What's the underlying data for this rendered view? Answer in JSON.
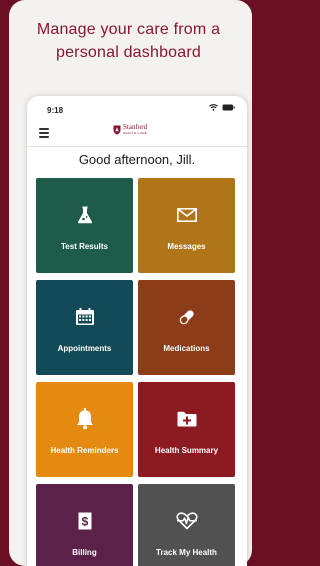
{
  "headline": {
    "line1": "Manage your care from a",
    "line2": "personal dashboard"
  },
  "status_bar": {
    "time": "9:18"
  },
  "app": {
    "logo_brand": "Stanford",
    "logo_sub": "HEALTH CARE",
    "greeting": "Good afternoon, Jill."
  },
  "tiles": [
    {
      "label": "Test Results",
      "icon": "flask-icon",
      "color": "#1e5b4b"
    },
    {
      "label": "Messages",
      "icon": "envelope-icon",
      "color": "#b07518"
    },
    {
      "label": "Appointments",
      "icon": "calendar-icon",
      "color": "#124a57"
    },
    {
      "label": "Medications",
      "icon": "pill-icon",
      "color": "#8c3c18"
    },
    {
      "label": "Health Reminders",
      "icon": "bell-icon",
      "color": "#e58a11"
    },
    {
      "label": "Health Summary",
      "icon": "medical-folder-icon",
      "color": "#8e1a21"
    },
    {
      "label": "Billing",
      "icon": "dollar-doc-icon",
      "color": "#5b2149"
    },
    {
      "label": "Track My Health",
      "icon": "heart-pulse-icon",
      "color": "#515151"
    }
  ],
  "colors": {
    "background": "#6b0f24",
    "brand": "#8c1431",
    "card": "#f4f2ef"
  }
}
